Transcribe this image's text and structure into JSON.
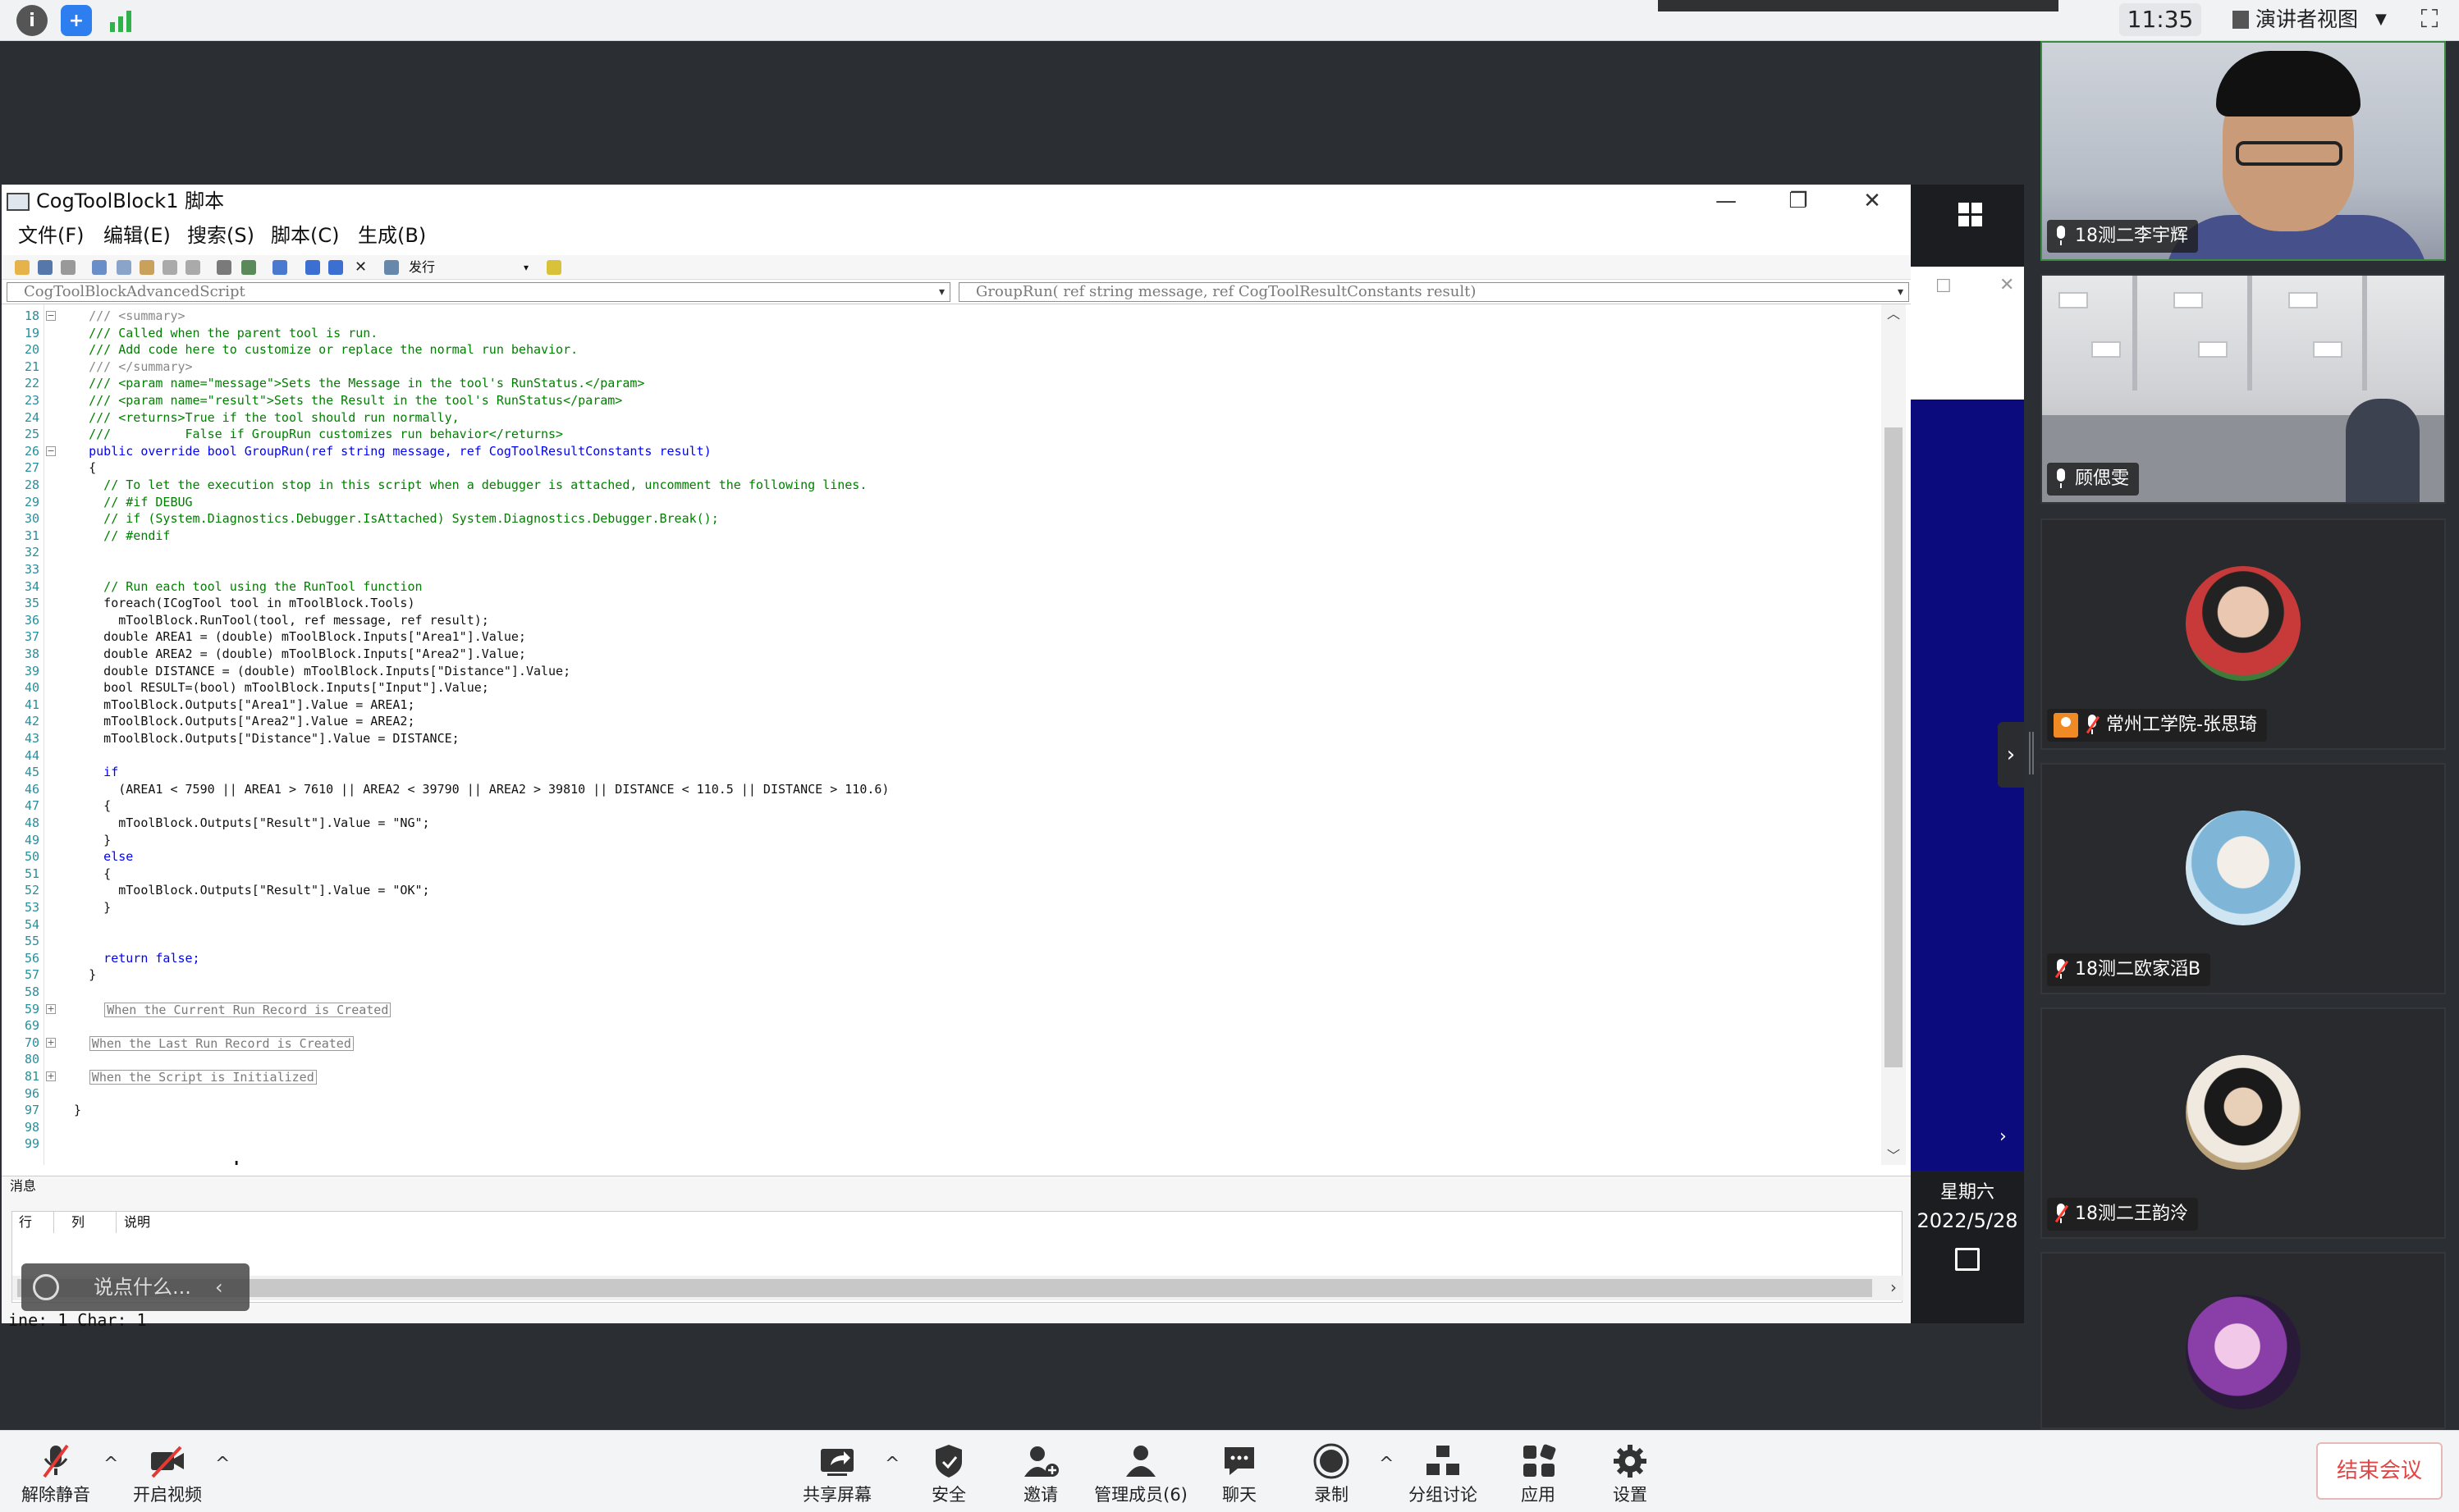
{
  "topbar": {
    "clock": "11:35",
    "view_label": "演讲者视图"
  },
  "editor": {
    "title": "CogToolBlock1 脚本",
    "menus": [
      "文件(F)",
      "编辑(E)",
      "搜索(S)",
      "脚本(C)",
      "生成(B)"
    ],
    "build_config": "发行",
    "class_combo": "CogToolBlockAdvancedScript",
    "member_combo": "GroupRun( ref string message,  ref CogToolResultConstants result)",
    "code_lines": [
      {
        "n": "18",
        "t": "    /// <summary>",
        "c": "gray"
      },
      {
        "n": "19",
        "t": "    /// Called when the parent tool is run.",
        "c": "green"
      },
      {
        "n": "20",
        "t": "    /// Add code here to customize or replace the normal run behavior.",
        "c": "green"
      },
      {
        "n": "21",
        "t": "    /// </summary>",
        "c": "gray"
      },
      {
        "n": "22",
        "t": "    /// <param name=\"message\">Sets the Message in the tool's RunStatus.</param>",
        "c": "green"
      },
      {
        "n": "23",
        "t": "    /// <param name=\"result\">Sets the Result in the tool's RunStatus</param>",
        "c": "green"
      },
      {
        "n": "24",
        "t": "    /// <returns>True if the tool should run normally,",
        "c": "green"
      },
      {
        "n": "25",
        "t": "    ///          False if GroupRun customizes run behavior</returns>",
        "c": "green"
      },
      {
        "n": "26",
        "t": "    public override bool GroupRun(ref string message, ref CogToolResultConstants result)",
        "c": "blue"
      },
      {
        "n": "27",
        "t": "    {",
        "c": ""
      },
      {
        "n": "28",
        "t": "      // To let the execution stop in this script when a debugger is attached, uncomment the following lines.",
        "c": "green"
      },
      {
        "n": "29",
        "t": "      // #if DEBUG",
        "c": "green"
      },
      {
        "n": "30",
        "t": "      // if (System.Diagnostics.Debugger.IsAttached) System.Diagnostics.Debugger.Break();",
        "c": "green"
      },
      {
        "n": "31",
        "t": "      // #endif",
        "c": "green"
      },
      {
        "n": "32",
        "t": "",
        "c": ""
      },
      {
        "n": "33",
        "t": "",
        "c": ""
      },
      {
        "n": "34",
        "t": "      // Run each tool using the RunTool function",
        "c": "green"
      },
      {
        "n": "35",
        "t": "      foreach(ICogTool tool in mToolBlock.Tools)",
        "c": ""
      },
      {
        "n": "36",
        "t": "        mToolBlock.RunTool(tool, ref message, ref result);",
        "c": ""
      },
      {
        "n": "37",
        "t": "      double AREA1 = (double) mToolBlock.Inputs[\"Area1\"].Value;",
        "c": ""
      },
      {
        "n": "38",
        "t": "      double AREA2 = (double) mToolBlock.Inputs[\"Area2\"].Value;",
        "c": ""
      },
      {
        "n": "39",
        "t": "      double DISTANCE = (double) mToolBlock.Inputs[\"Distance\"].Value;",
        "c": ""
      },
      {
        "n": "40",
        "t": "      bool RESULT=(bool) mToolBlock.Inputs[\"Input\"].Value;",
        "c": ""
      },
      {
        "n": "41",
        "t": "      mToolBlock.Outputs[\"Area1\"].Value = AREA1;",
        "c": ""
      },
      {
        "n": "42",
        "t": "      mToolBlock.Outputs[\"Area2\"].Value = AREA2;",
        "c": ""
      },
      {
        "n": "43",
        "t": "      mToolBlock.Outputs[\"Distance\"].Value = DISTANCE;",
        "c": ""
      },
      {
        "n": "44",
        "t": "",
        "c": ""
      },
      {
        "n": "45",
        "t": "      if",
        "c": "blue"
      },
      {
        "n": "46",
        "t": "        (AREA1 < 7590 || AREA1 > 7610 || AREA2 < 39790 || AREA2 > 39810 || DISTANCE < 110.5 || DISTANCE > 110.6)",
        "c": ""
      },
      {
        "n": "47",
        "t": "      {",
        "c": ""
      },
      {
        "n": "48",
        "t": "        mToolBlock.Outputs[\"Result\"].Value = \"NG\";",
        "c": ""
      },
      {
        "n": "49",
        "t": "      }",
        "c": ""
      },
      {
        "n": "50",
        "t": "      else",
        "c": "blue"
      },
      {
        "n": "51",
        "t": "      {",
        "c": ""
      },
      {
        "n": "52",
        "t": "        mToolBlock.Outputs[\"Result\"].Value = \"OK\";",
        "c": ""
      },
      {
        "n": "53",
        "t": "      }",
        "c": ""
      },
      {
        "n": "54",
        "t": "",
        "c": ""
      },
      {
        "n": "55",
        "t": "",
        "c": ""
      },
      {
        "n": "56",
        "t": "      return false;",
        "c": "blue"
      },
      {
        "n": "57",
        "t": "    }",
        "c": ""
      },
      {
        "n": "58",
        "t": "",
        "c": ""
      },
      {
        "n": "59",
        "t": "",
        "c": "",
        "region": "When the Current Run Record is Created",
        "indent": 6
      },
      {
        "n": "69",
        "t": "",
        "c": ""
      },
      {
        "n": "70",
        "t": "",
        "c": "",
        "region": "When the Last Run Record is Created",
        "indent": 4
      },
      {
        "n": "80",
        "t": "",
        "c": ""
      },
      {
        "n": "81",
        "t": "",
        "c": "",
        "region": "When the Script is Initialized",
        "indent": 4
      },
      {
        "n": "96",
        "t": "",
        "c": ""
      },
      {
        "n": "97",
        "t": "  }",
        "c": ""
      },
      {
        "n": "98",
        "t": "",
        "c": ""
      },
      {
        "n": "99",
        "t": "",
        "c": ""
      }
    ],
    "messages_tab": "消息",
    "msg_headers": [
      "行",
      "列",
      "说明"
    ],
    "status": "ine: 1  Char: 1",
    "chat_placeholder": "说点什么..."
  },
  "shared_right": {
    "weekday": "星期六",
    "date": "2022/5/28"
  },
  "participants": [
    {
      "name": "18测二李宇辉",
      "muted": false,
      "kind": "video"
    },
    {
      "name": "顾偲雯",
      "muted": false,
      "kind": "room"
    },
    {
      "name": "常州工学院-张思琦",
      "muted": true,
      "kind": "avatar",
      "host": true
    },
    {
      "name": "18测二欧家滔B",
      "muted": true,
      "kind": "avatar"
    },
    {
      "name": "18测二王韵泠",
      "muted": true,
      "kind": "avatar"
    },
    {
      "name": "",
      "muted": true,
      "kind": "avatar"
    }
  ],
  "toolbar": {
    "unmute": "解除静音",
    "start_video": "开启视频",
    "share": "共享屏幕",
    "security": "安全",
    "invite": "邀请",
    "participants": "管理成员(6)",
    "chat": "聊天",
    "record": "录制",
    "breakout": "分组讨论",
    "apps": "应用",
    "settings": "设置",
    "end": "结束会议"
  }
}
